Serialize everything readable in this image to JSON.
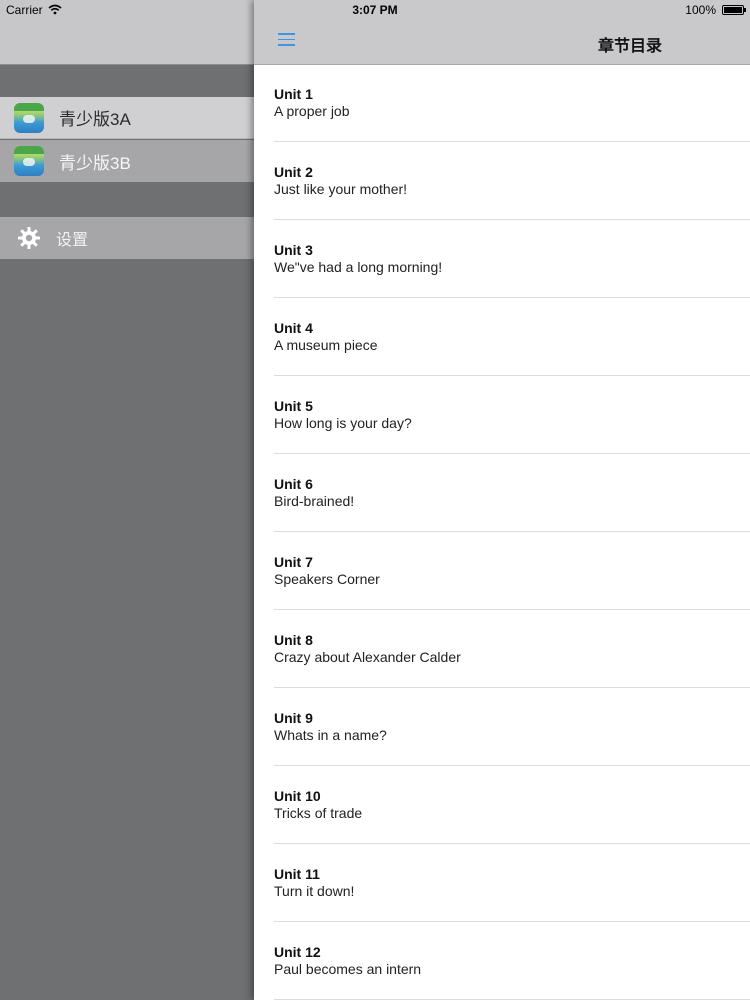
{
  "status_bar": {
    "carrier": "Carrier",
    "time": "3:07 PM",
    "battery": "100%"
  },
  "side_menu": {
    "books": [
      {
        "label": "青少版3A",
        "icon": "book-cover-icon"
      },
      {
        "label": "青少版3B",
        "icon": "book-cover-icon"
      }
    ],
    "settings": {
      "label": "设置",
      "icon": "gear-icon"
    }
  },
  "nav": {
    "title": "章节目录",
    "menu_icon": "hamburger-icon",
    "accent": "#3f95de"
  },
  "units": [
    {
      "title": "Unit 1",
      "subtitle": "A proper job"
    },
    {
      "title": "Unit 2",
      "subtitle": "Just like your mother!"
    },
    {
      "title": "Unit 3",
      "subtitle": "We\"ve had a long morning!"
    },
    {
      "title": "Unit 4",
      "subtitle": "A museum piece"
    },
    {
      "title": "Unit 5",
      "subtitle": "How long is your day?"
    },
    {
      "title": "Unit 6",
      "subtitle": "Bird-brained!"
    },
    {
      "title": "Unit 7",
      "subtitle": "Speakers Corner"
    },
    {
      "title": "Unit 8",
      "subtitle": "Crazy about Alexander Calder"
    },
    {
      "title": "Unit 9",
      "subtitle": "Whats in a name?"
    },
    {
      "title": "Unit 10",
      "subtitle": "Tricks of trade"
    },
    {
      "title": "Unit 11",
      "subtitle": "Turn it down!"
    },
    {
      "title": "Unit 12",
      "subtitle": "Paul becomes an intern"
    }
  ]
}
